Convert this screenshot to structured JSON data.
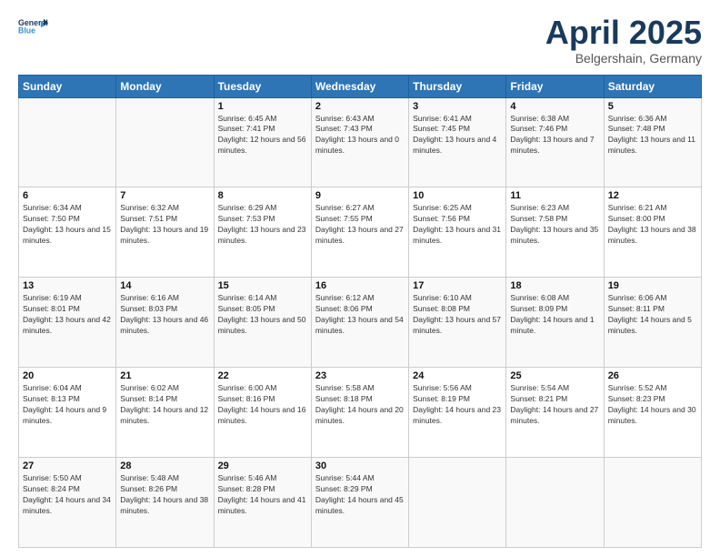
{
  "header": {
    "logo_line1": "General",
    "logo_line2": "Blue",
    "title": "April 2025",
    "subtitle": "Belgershain, Germany"
  },
  "days_of_week": [
    "Sunday",
    "Monday",
    "Tuesday",
    "Wednesday",
    "Thursday",
    "Friday",
    "Saturday"
  ],
  "weeks": [
    [
      {
        "day": "",
        "info": ""
      },
      {
        "day": "",
        "info": ""
      },
      {
        "day": "1",
        "info": "Sunrise: 6:45 AM\nSunset: 7:41 PM\nDaylight: 12 hours and 56 minutes."
      },
      {
        "day": "2",
        "info": "Sunrise: 6:43 AM\nSunset: 7:43 PM\nDaylight: 13 hours and 0 minutes."
      },
      {
        "day": "3",
        "info": "Sunrise: 6:41 AM\nSunset: 7:45 PM\nDaylight: 13 hours and 4 minutes."
      },
      {
        "day": "4",
        "info": "Sunrise: 6:38 AM\nSunset: 7:46 PM\nDaylight: 13 hours and 7 minutes."
      },
      {
        "day": "5",
        "info": "Sunrise: 6:36 AM\nSunset: 7:48 PM\nDaylight: 13 hours and 11 minutes."
      }
    ],
    [
      {
        "day": "6",
        "info": "Sunrise: 6:34 AM\nSunset: 7:50 PM\nDaylight: 13 hours and 15 minutes."
      },
      {
        "day": "7",
        "info": "Sunrise: 6:32 AM\nSunset: 7:51 PM\nDaylight: 13 hours and 19 minutes."
      },
      {
        "day": "8",
        "info": "Sunrise: 6:29 AM\nSunset: 7:53 PM\nDaylight: 13 hours and 23 minutes."
      },
      {
        "day": "9",
        "info": "Sunrise: 6:27 AM\nSunset: 7:55 PM\nDaylight: 13 hours and 27 minutes."
      },
      {
        "day": "10",
        "info": "Sunrise: 6:25 AM\nSunset: 7:56 PM\nDaylight: 13 hours and 31 minutes."
      },
      {
        "day": "11",
        "info": "Sunrise: 6:23 AM\nSunset: 7:58 PM\nDaylight: 13 hours and 35 minutes."
      },
      {
        "day": "12",
        "info": "Sunrise: 6:21 AM\nSunset: 8:00 PM\nDaylight: 13 hours and 38 minutes."
      }
    ],
    [
      {
        "day": "13",
        "info": "Sunrise: 6:19 AM\nSunset: 8:01 PM\nDaylight: 13 hours and 42 minutes."
      },
      {
        "day": "14",
        "info": "Sunrise: 6:16 AM\nSunset: 8:03 PM\nDaylight: 13 hours and 46 minutes."
      },
      {
        "day": "15",
        "info": "Sunrise: 6:14 AM\nSunset: 8:05 PM\nDaylight: 13 hours and 50 minutes."
      },
      {
        "day": "16",
        "info": "Sunrise: 6:12 AM\nSunset: 8:06 PM\nDaylight: 13 hours and 54 minutes."
      },
      {
        "day": "17",
        "info": "Sunrise: 6:10 AM\nSunset: 8:08 PM\nDaylight: 13 hours and 57 minutes."
      },
      {
        "day": "18",
        "info": "Sunrise: 6:08 AM\nSunset: 8:09 PM\nDaylight: 14 hours and 1 minute."
      },
      {
        "day": "19",
        "info": "Sunrise: 6:06 AM\nSunset: 8:11 PM\nDaylight: 14 hours and 5 minutes."
      }
    ],
    [
      {
        "day": "20",
        "info": "Sunrise: 6:04 AM\nSunset: 8:13 PM\nDaylight: 14 hours and 9 minutes."
      },
      {
        "day": "21",
        "info": "Sunrise: 6:02 AM\nSunset: 8:14 PM\nDaylight: 14 hours and 12 minutes."
      },
      {
        "day": "22",
        "info": "Sunrise: 6:00 AM\nSunset: 8:16 PM\nDaylight: 14 hours and 16 minutes."
      },
      {
        "day": "23",
        "info": "Sunrise: 5:58 AM\nSunset: 8:18 PM\nDaylight: 14 hours and 20 minutes."
      },
      {
        "day": "24",
        "info": "Sunrise: 5:56 AM\nSunset: 8:19 PM\nDaylight: 14 hours and 23 minutes."
      },
      {
        "day": "25",
        "info": "Sunrise: 5:54 AM\nSunset: 8:21 PM\nDaylight: 14 hours and 27 minutes."
      },
      {
        "day": "26",
        "info": "Sunrise: 5:52 AM\nSunset: 8:23 PM\nDaylight: 14 hours and 30 minutes."
      }
    ],
    [
      {
        "day": "27",
        "info": "Sunrise: 5:50 AM\nSunset: 8:24 PM\nDaylight: 14 hours and 34 minutes."
      },
      {
        "day": "28",
        "info": "Sunrise: 5:48 AM\nSunset: 8:26 PM\nDaylight: 14 hours and 38 minutes."
      },
      {
        "day": "29",
        "info": "Sunrise: 5:46 AM\nSunset: 8:28 PM\nDaylight: 14 hours and 41 minutes."
      },
      {
        "day": "30",
        "info": "Sunrise: 5:44 AM\nSunset: 8:29 PM\nDaylight: 14 hours and 45 minutes."
      },
      {
        "day": "",
        "info": ""
      },
      {
        "day": "",
        "info": ""
      },
      {
        "day": "",
        "info": ""
      }
    ]
  ]
}
